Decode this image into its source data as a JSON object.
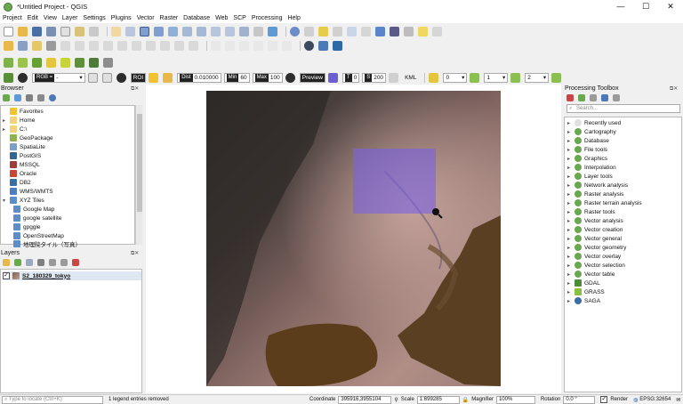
{
  "window": {
    "title": "*Untitled Project - QGIS",
    "minimize": "—",
    "maximize": "☐",
    "close": "✕"
  },
  "menu": [
    "Project",
    "Edit",
    "View",
    "Layer",
    "Settings",
    "Plugins",
    "Vector",
    "Raster",
    "Database",
    "Web",
    "SCP",
    "Processing",
    "Help"
  ],
  "scp_toolbar": {
    "rgb_label": "RGB =",
    "rgb_value": "-",
    "roi_label": "ROI",
    "dist_label": "Dist",
    "dist_value": "0.010000",
    "min_label": "Min",
    "min_value": "60",
    "max_label": "Max",
    "max_value": "100",
    "preview_label": "Preview",
    "t_value": "0",
    "pixels_value": "200",
    "kml_label": "KML",
    "n0": "0",
    "n1": "1",
    "n2": "2"
  },
  "browser": {
    "title": "Browser",
    "items": [
      {
        "label": "Favorites",
        "expander": "",
        "icon_color": "#f2c230"
      },
      {
        "label": "Home",
        "expander": "▸",
        "icon_color": "#f2d27a"
      },
      {
        "label": "C:\\",
        "expander": "▸",
        "icon_color": "#9a9a9a"
      },
      {
        "label": "GeoPackage",
        "expander": "",
        "icon_color": "#8fb24f"
      },
      {
        "label": "SpatiaLite",
        "expander": "",
        "icon_color": "#7d9fc7"
      },
      {
        "label": "PostGIS",
        "expander": "",
        "icon_color": "#336791"
      },
      {
        "label": "MSSQL",
        "expander": "",
        "icon_color": "#a23b3b"
      },
      {
        "label": "Oracle",
        "expander": "",
        "icon_color": "#c74634"
      },
      {
        "label": "DB2",
        "expander": "",
        "icon_color": "#3b6ea5"
      },
      {
        "label": "WMS/WMTS",
        "expander": "",
        "icon_color": "#4d7ec2"
      },
      {
        "label": "XYZ Tiles",
        "expander": "▾",
        "icon_color": "#5e8ec9"
      },
      {
        "label": "Google Map",
        "expander": "",
        "icon_color": "#5e8ec9"
      },
      {
        "label": "google satellite",
        "expander": "",
        "icon_color": "#5e8ec9"
      },
      {
        "label": "gpggle",
        "expander": "",
        "icon_color": "#5e8ec9"
      },
      {
        "label": "OpenStreetMap",
        "expander": "",
        "icon_color": "#5e8ec9"
      },
      {
        "label": "地理院タイル（写真）",
        "expander": "",
        "icon_color": "#5e8ec9"
      }
    ]
  },
  "layers": {
    "title": "Layers",
    "items": [
      {
        "label": "S2_180329_tokyo",
        "checked": true
      }
    ]
  },
  "toolbox": {
    "title": "Processing Toolbox",
    "search_placeholder": "Search...",
    "items": [
      "Recently used",
      "Cartography",
      "Database",
      "File tools",
      "Graphics",
      "Interpolation",
      "Layer tools",
      "Network analysis",
      "Raster analysis",
      "Raster terrain analysis",
      "Raster tools",
      "Vector analysis",
      "Vector creation",
      "Vector general",
      "Vector geometry",
      "Vector overlay",
      "Vector selection",
      "Vector table",
      "GDAL",
      "GRASS",
      "SAGA"
    ]
  },
  "status": {
    "locate_placeholder": "Type to locate (Ctrl+K)",
    "message": "1 legend entries removed",
    "coordinate_label": "Coordinate",
    "coordinate": "395916,3955104",
    "scale_label": "Scale",
    "scale": "1:699285",
    "magnifier_label": "Magnifier",
    "magnifier": "100%",
    "rotation_label": "Rotation",
    "rotation": "0.0 °",
    "render_label": "Render",
    "crs": "EPSG:32654"
  }
}
